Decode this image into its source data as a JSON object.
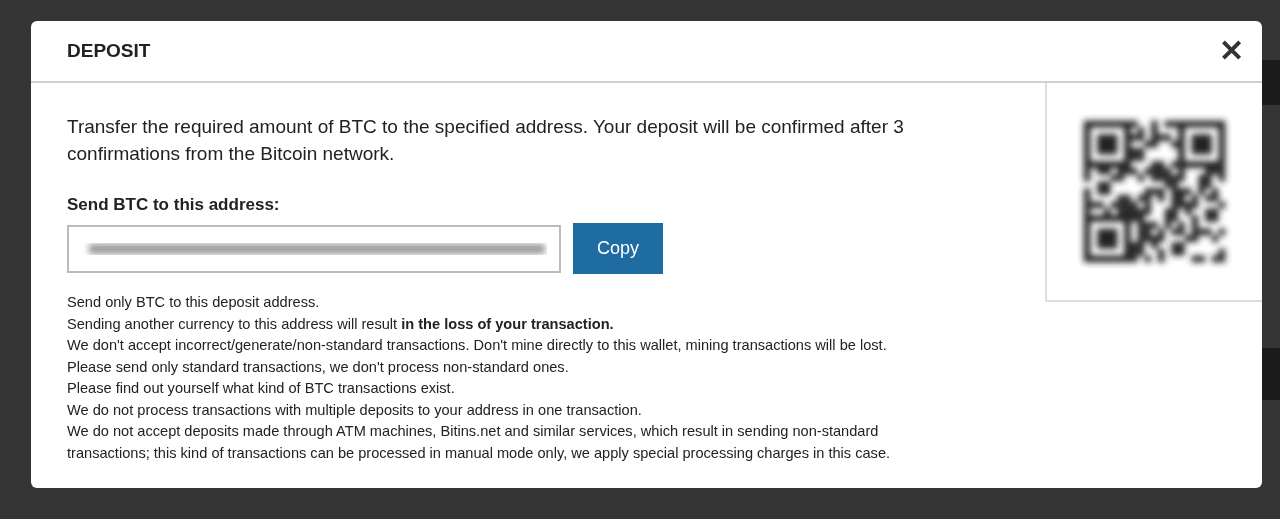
{
  "dialog": {
    "title": "DEPOSIT",
    "close": "✕",
    "intro": "Transfer the required amount of BTC to the specified address. Your deposit will be confirmed after 3 confirmations from the Bitcoin network.",
    "address_label": "Send BTC to this address:",
    "copy_button": "Copy",
    "notices": [
      "Send only BTC to this deposit address.",
      "Sending another currency to this address will result **in the loss of your transaction.**",
      "We don't accept incorrect/generate/non-standard transactions. Don't mine directly to this wallet, mining transactions will be lost.",
      "Please send only standard transactions, we don't process non-standard ones.",
      "Please find out yourself what kind of BTC transactions exist.",
      "We do not process transactions with multiple deposits to your address in one transaction.",
      "We do not accept deposits made through ATM machines, Bitins.net and similar services, which result in sending non-standard transactions; this kind of transactions can be processed in manual mode only, we apply special processing charges in this case."
    ]
  }
}
